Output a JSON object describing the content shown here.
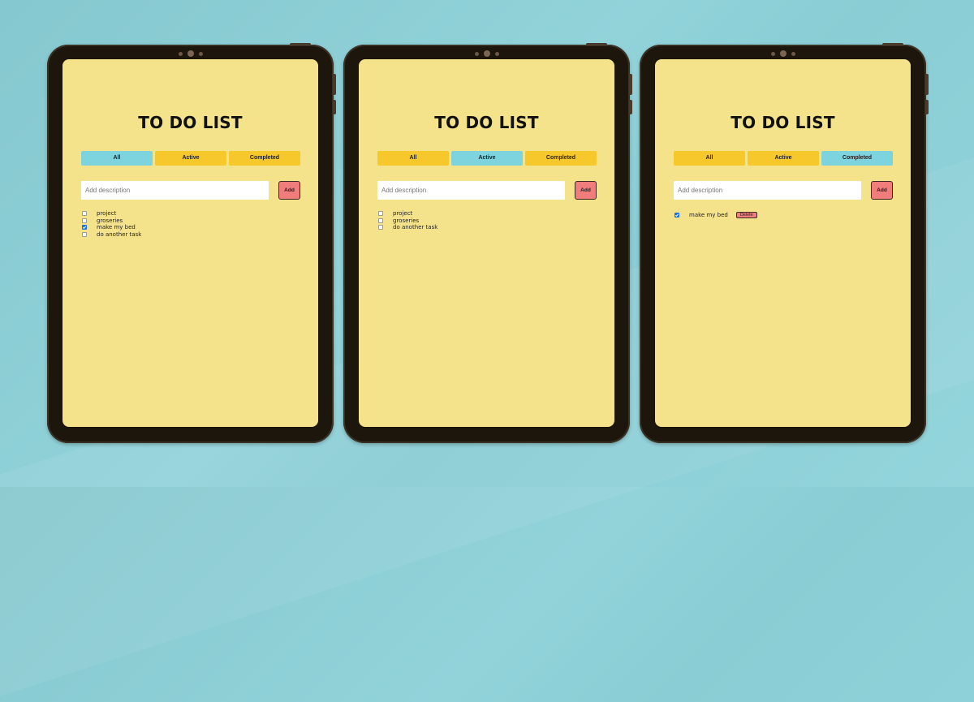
{
  "app_title": "TO DO LIST",
  "filters": {
    "all": "All",
    "active": "Active",
    "completed": "Completed"
  },
  "add_form": {
    "placeholder": "Add description",
    "add_label": "Add"
  },
  "screens": [
    {
      "view": "All",
      "selected_filter": "all",
      "tasks": [
        {
          "label": "project",
          "checked": false
        },
        {
          "label": "groseries",
          "checked": false
        },
        {
          "label": "make my bed",
          "checked": true
        },
        {
          "label": "do another task",
          "checked": false
        }
      ]
    },
    {
      "view": "Active",
      "selected_filter": "active",
      "tasks": [
        {
          "label": "project",
          "checked": false
        },
        {
          "label": "groseries",
          "checked": false
        },
        {
          "label": "do another task",
          "checked": false
        }
      ]
    },
    {
      "view": "Completed",
      "selected_filter": "completed",
      "tasks": [
        {
          "label": "make my bed",
          "checked": true,
          "delete_label": "Delete"
        }
      ]
    }
  ],
  "colors": {
    "background": "#8fd0d6",
    "tablet_frame": "#1d160d",
    "screen": "#f5e38b",
    "filter_default": "#f7c82b",
    "filter_selected": "#7dd4df",
    "button_red": "#f17c7c",
    "checkbox_checked": "#1a73e8"
  },
  "icons": {
    "camera": "camera-icon",
    "checkbox": "checkbox-icon"
  }
}
